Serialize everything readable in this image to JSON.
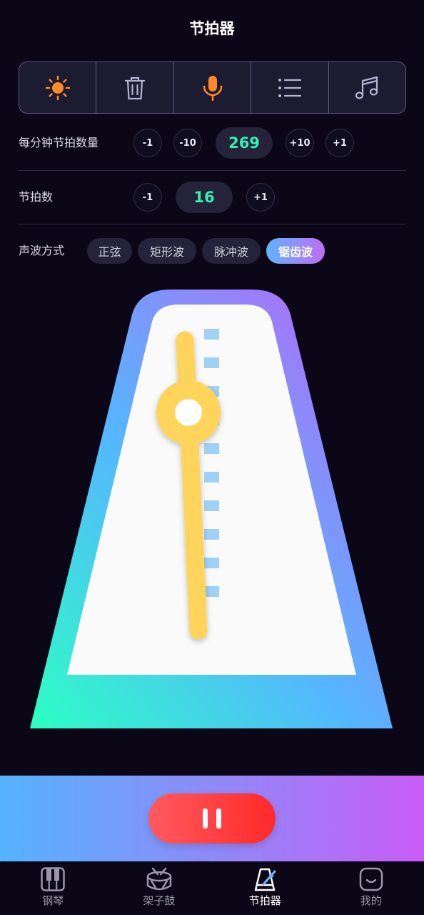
{
  "header": {
    "title": "节拍器"
  },
  "toolbar": {
    "items": [
      {
        "icon": "sun-icon"
      },
      {
        "icon": "trash-icon"
      },
      {
        "icon": "microphone-icon"
      },
      {
        "icon": "list-icon"
      },
      {
        "icon": "music-note-icon"
      }
    ]
  },
  "bpm": {
    "label": "每分钟节拍数量",
    "minus1": "-1",
    "minus10": "-10",
    "value": "269",
    "plus10": "+10",
    "plus1": "+1"
  },
  "beats": {
    "label": "节拍数",
    "minus1": "-1",
    "value": "16",
    "plus1": "+1"
  },
  "waveform": {
    "label": "声波方式",
    "options": [
      "正弦",
      "矩形波",
      "脉冲波",
      "锯齿波"
    ],
    "selected": "锯齿波"
  },
  "tabbar": {
    "items": [
      {
        "label": "钢琴",
        "icon": "piano-icon"
      },
      {
        "label": "架子鼓",
        "icon": "drum-icon"
      },
      {
        "label": "节拍器",
        "icon": "metronome-icon",
        "active": true
      },
      {
        "label": "我的",
        "icon": "profile-icon"
      }
    ]
  },
  "colors": {
    "background": "#0b0717",
    "accent_green": "#35f0b4",
    "accent_orange": "#ff8a2a",
    "pendulum": "#ffd45a",
    "pause_button": "#ff3b3b"
  }
}
